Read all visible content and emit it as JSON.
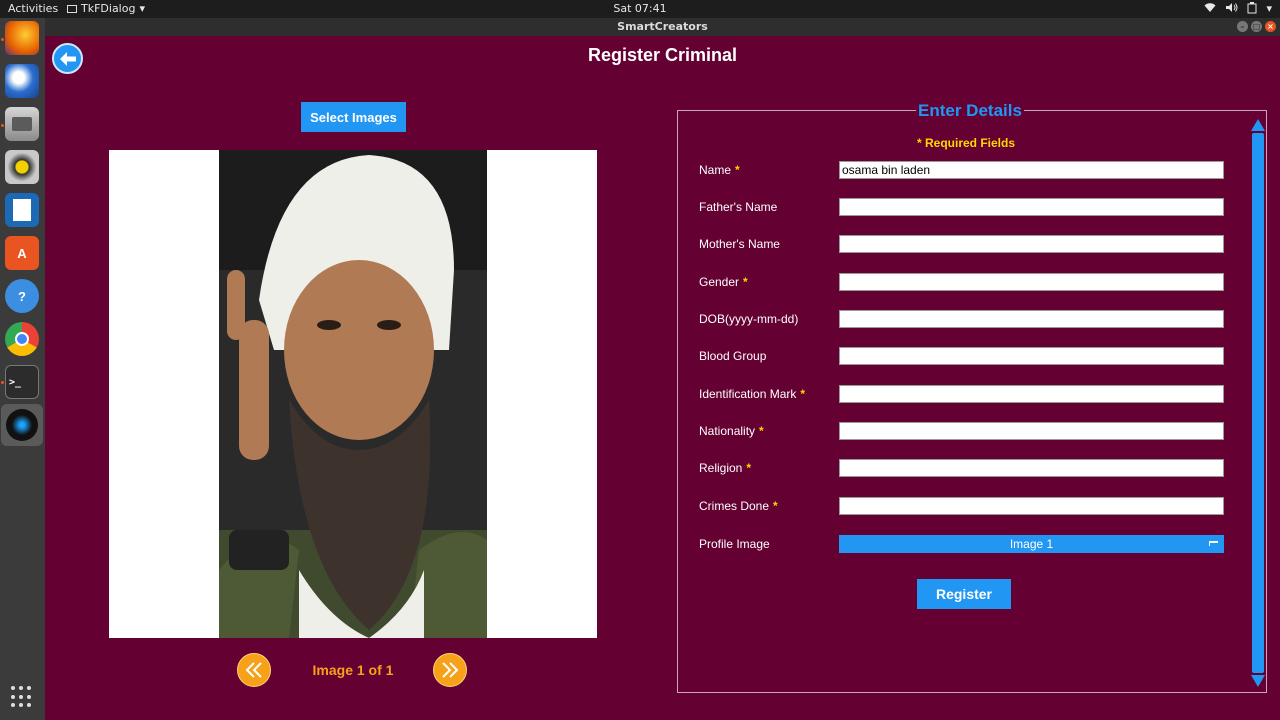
{
  "topbar": {
    "activities": "Activities",
    "app_menu": "TkFDialog",
    "clock": "Sat 07:41"
  },
  "window": {
    "title": "SmartCreators"
  },
  "dock": {
    "items": [
      {
        "icon": "firefox-icon",
        "color": "#e66000"
      },
      {
        "icon": "thunderbird-icon",
        "color": "#2a6fd0"
      },
      {
        "icon": "files-icon",
        "color": "#8a8a8a"
      },
      {
        "icon": "rhythmbox-icon",
        "color": "#c7a500"
      },
      {
        "icon": "writer-icon",
        "color": "#1c69b5"
      },
      {
        "icon": "software-icon",
        "color": "#e95420"
      },
      {
        "icon": "help-icon",
        "color": "#3c8ee0"
      },
      {
        "icon": "chrome-icon",
        "color": "#4caf50"
      },
      {
        "icon": "terminal-icon",
        "color": "#2c2c2c"
      },
      {
        "icon": "smartcreators-icon",
        "color": "#111111"
      }
    ],
    "terminal_glyph": ">_"
  },
  "app": {
    "title": "Register Criminal",
    "select_images_label": "Select Images",
    "image_counter": "Image 1 of 1",
    "details": {
      "legend": "Enter Details",
      "required_note": "* Required Fields",
      "required_marker": "*",
      "fields": [
        {
          "label": "Name",
          "required": true,
          "value": "osama bin laden"
        },
        {
          "label": "Father's Name",
          "required": false,
          "value": ""
        },
        {
          "label": "Mother's Name",
          "required": false,
          "value": ""
        },
        {
          "label": "Gender",
          "required": true,
          "value": ""
        },
        {
          "label": "DOB(yyyy-mm-dd)",
          "required": false,
          "value": ""
        },
        {
          "label": "Blood Group",
          "required": false,
          "value": ""
        },
        {
          "label": "Identification Mark",
          "required": true,
          "value": ""
        },
        {
          "label": "Nationality",
          "required": true,
          "value": ""
        },
        {
          "label": "Religion",
          "required": true,
          "value": ""
        },
        {
          "label": "Crimes Done",
          "required": true,
          "value": ""
        }
      ],
      "profile_image_label": "Profile Image",
      "profile_image_value": "Image 1",
      "register_label": "Register"
    },
    "colors": {
      "background": "#640032",
      "accent_blue": "#2196f3",
      "nav_orange": "#f7a11a",
      "required_yellow": "#ffd700"
    }
  }
}
